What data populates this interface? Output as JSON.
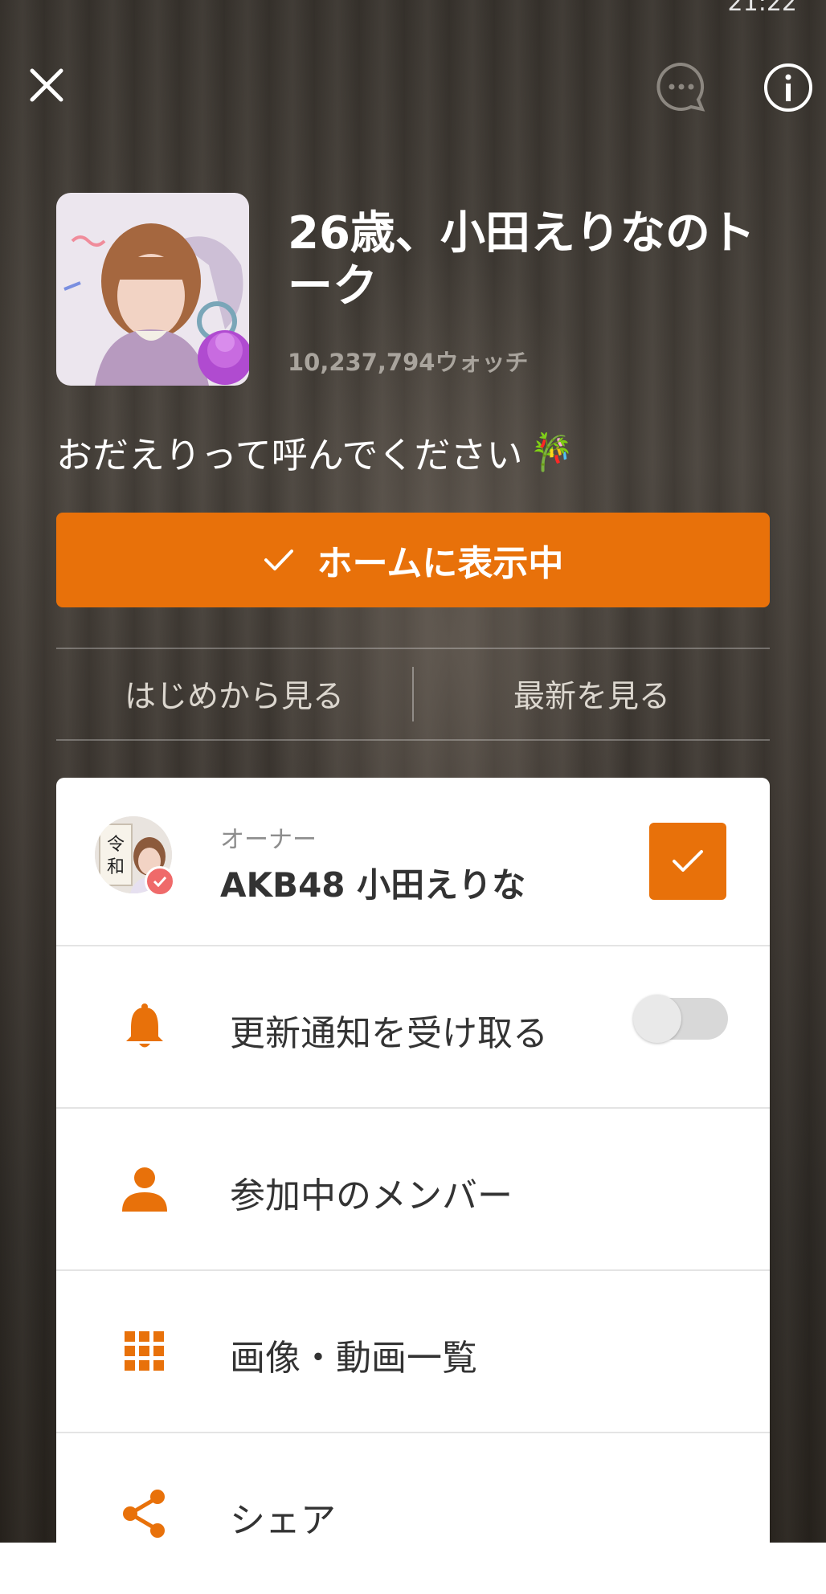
{
  "status_bar": {
    "time": "21:22"
  },
  "header": {
    "close": "close",
    "chat": "chat",
    "info": "info"
  },
  "profile": {
    "title": "26歳、小田えりなのトーク",
    "watch_count": "10,237,794ウォッチ",
    "description": "おだえりって呼んでください",
    "description_emoji": "🎋"
  },
  "primary_button": {
    "label": "ホームに表示中"
  },
  "tabs": [
    {
      "label": "はじめから見る"
    },
    {
      "label": "最新を見る"
    }
  ],
  "owner": {
    "sublabel": "オーナー",
    "name": "AKB48 小田えりな",
    "avatar_text": "令和"
  },
  "menu": {
    "notify": {
      "label": "更新通知を受け取る",
      "toggle_on": false
    },
    "members": {
      "label": "参加中のメンバー"
    },
    "media": {
      "label": "画像・動画一覧"
    },
    "share": {
      "label": "シェア"
    }
  },
  "colors": {
    "accent": "#e8710a"
  }
}
